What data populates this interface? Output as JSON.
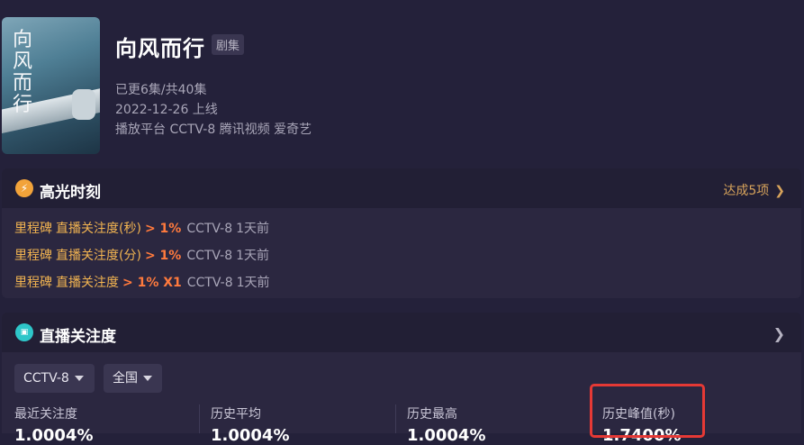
{
  "show": {
    "poster_title": "向风而行",
    "poster_logo": "",
    "title": "向风而行",
    "tag": "剧集",
    "episodes": "已更6集/共40集",
    "release": "2022-12-26 上线",
    "platforms": "播放平台 CCTV-8 腾讯视频 爱奇艺"
  },
  "highlights": {
    "title": "高光时刻",
    "icon": "bolt-icon",
    "more_label": "达成5项",
    "more_chevron": "❯",
    "items": [
      {
        "label": "里程碑",
        "metric": "直播关注度(秒)",
        "value": "> 1%",
        "channel": "CCTV-8",
        "time": "1天前"
      },
      {
        "label": "里程碑",
        "metric": "直播关注度(分)",
        "value": "> 1%",
        "channel": "CCTV-8",
        "time": "1天前"
      },
      {
        "label": "里程碑",
        "metric": "直播关注度",
        "value": "> 1% X1",
        "channel": "CCTV-8",
        "time": "1天前"
      }
    ]
  },
  "live": {
    "title": "直播关注度",
    "icon": "live-tv-icon",
    "chevron": "❯",
    "channel_select": "CCTV-8",
    "region_select": "全国",
    "stats": [
      {
        "label": "最近关注度",
        "value": "1.0004%"
      },
      {
        "label": "历史平均",
        "value": "1.0004%"
      },
      {
        "label": "历史最高",
        "value": "1.0004%"
      },
      {
        "label": "历史峰值(秒)",
        "value": "1.7400%"
      }
    ]
  },
  "colors": {
    "background": "#24213a",
    "card": "#2b2740",
    "accent_gold": "#f2b451",
    "accent_orange": "#ff7a3d",
    "highlight_red": "#e53935"
  }
}
